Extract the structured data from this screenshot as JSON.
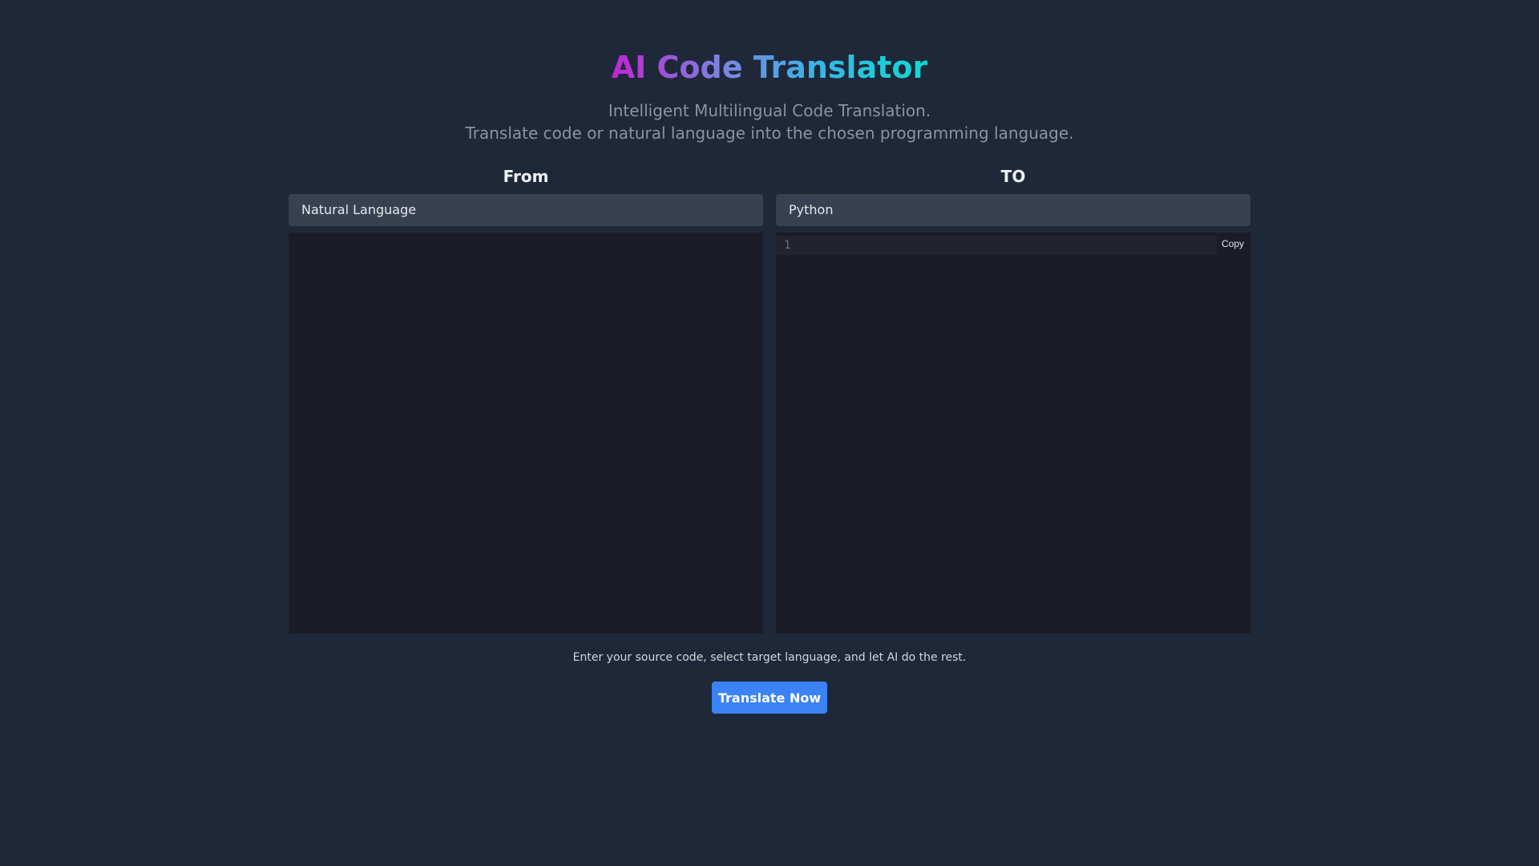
{
  "header": {
    "title": "AI Code Translator",
    "subtitle_line1": "Intelligent Multilingual Code Translation.",
    "subtitle_line2": "Translate code or natural language into the chosen programming language."
  },
  "source": {
    "label": "From",
    "selected_language": "Natural Language",
    "content": ""
  },
  "target": {
    "label": "TO",
    "selected_language": "Python",
    "line_number": "1",
    "copy_label": "Copy",
    "content": ""
  },
  "footer": {
    "hint": "Enter your source code, select target language, and let AI do the rest.",
    "translate_button": "Translate Now"
  },
  "colors": {
    "background": "#1e2839",
    "panel": "#374151",
    "editor": "#1b1c27",
    "accent_button": "#3b82f6",
    "title_gradient": [
      "#c026d3",
      "#7c83e0",
      "#38b6e6",
      "#10d9d0"
    ]
  }
}
